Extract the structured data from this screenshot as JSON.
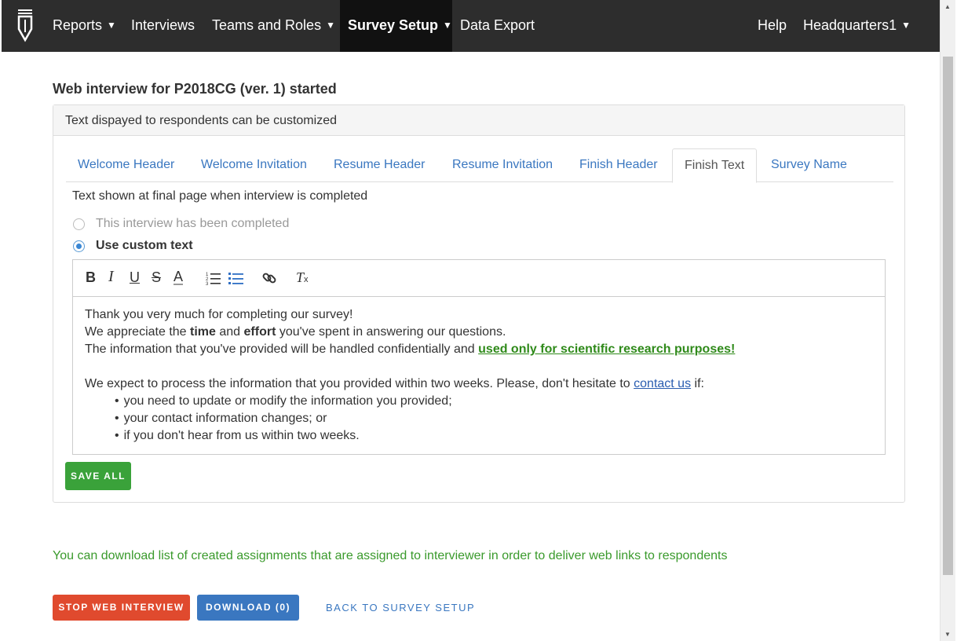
{
  "nav": {
    "items": [
      {
        "label": "Reports",
        "caret": true
      },
      {
        "label": "Interviews",
        "caret": false
      },
      {
        "label": "Teams and Roles",
        "caret": true
      },
      {
        "label": "Survey Setup",
        "caret": true,
        "active": true
      },
      {
        "label": "Data Export",
        "caret": false
      }
    ],
    "help": "Help",
    "user": "Headquarters1",
    "caret_glyph": "▼"
  },
  "page": {
    "title": "Web interview for P2018CG (ver. 1) started"
  },
  "panel": {
    "heading": "Text dispayed to respondents can be customized",
    "tabs": [
      {
        "label": "Welcome Header"
      },
      {
        "label": "Welcome Invitation"
      },
      {
        "label": "Resume Header"
      },
      {
        "label": "Resume Invitation"
      },
      {
        "label": "Finish Header"
      },
      {
        "label": "Finish Text",
        "active": true
      },
      {
        "label": "Survey Name"
      }
    ],
    "description": "Text shown at final page when interview is completed",
    "options": [
      {
        "label": "This interview has been completed",
        "checked": false
      },
      {
        "label": "Use custom text",
        "checked": true
      }
    ],
    "toolbar_icons": [
      "bold-icon",
      "italic-icon",
      "underline-icon",
      "strikethrough-icon",
      "text-color-icon",
      "ordered-list-icon",
      "bullet-list-icon",
      "link-icon",
      "clear-format-icon"
    ],
    "editor": {
      "line1": "Thank you very much for completing our survey!",
      "line2_a": "We appreciate the ",
      "line2_b": "time",
      "line2_c": " and ",
      "line2_d": "effort",
      "line2_e": " you've spent in answering our questions.",
      "line3_a": "The information that you've provided will be handled confidentially and ",
      "line3_link": "used only for scientific research purposes!",
      "line4_a": "We expect to process the information that you provided within two weeks. Please, don't hesitate to ",
      "line4_link": "contact us",
      "line4_b": " if:",
      "bullets": [
        "you need to update or modify the information you provided;",
        "your contact information changes; or",
        "if you don't hear from us within two weeks."
      ]
    },
    "save_label": "SAVE ALL"
  },
  "info_text": "You can download list of created assignments that are assigned to interviewer in order to deliver web links to respondents",
  "actions": {
    "stop": "STOP WEB INTERVIEW",
    "download": "DOWNLOAD (0)",
    "back": "BACK TO SURVEY SETUP"
  },
  "colors": {
    "navbar": "#2d2d2d",
    "link": "#3a77c0",
    "success": "#3aa23a",
    "danger": "#e04a2e"
  }
}
